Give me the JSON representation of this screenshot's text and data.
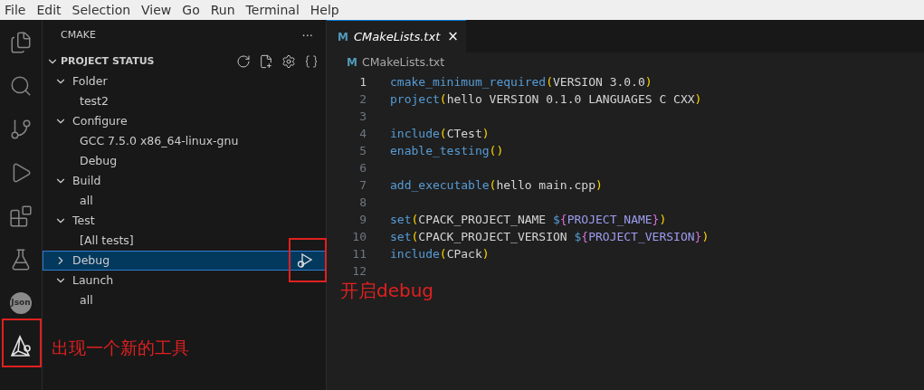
{
  "menu": [
    "File",
    "Edit",
    "Selection",
    "View",
    "Go",
    "Run",
    "Terminal",
    "Help"
  ],
  "activity_bar": [
    {
      "kind": "files"
    },
    {
      "kind": "search"
    },
    {
      "kind": "scm"
    },
    {
      "kind": "debug"
    },
    {
      "kind": "extensions"
    },
    {
      "kind": "flask"
    },
    {
      "kind": "json",
      "label": "Json"
    },
    {
      "kind": "cmake"
    }
  ],
  "sidebar": {
    "title": "CMAKE",
    "more": "···",
    "section": {
      "title": "PROJECT STATUS",
      "expanded": true,
      "actions": [
        {
          "kind": "refresh"
        },
        {
          "kind": "new-file"
        },
        {
          "kind": "settings"
        },
        {
          "kind": "braces"
        }
      ]
    },
    "items": [
      {
        "kind": "group",
        "label": "Folder",
        "expanded": true,
        "selected": false,
        "children": [
          {
            "label": "test2"
          }
        ]
      },
      {
        "kind": "group",
        "label": "Configure",
        "expanded": true,
        "selected": false,
        "children": [
          {
            "label": "GCC 7.5.0 x86_64-linux-gnu"
          },
          {
            "label": "Debug"
          }
        ]
      },
      {
        "kind": "group",
        "label": "Build",
        "expanded": true,
        "selected": false,
        "children": [
          {
            "label": "all"
          }
        ]
      },
      {
        "kind": "group",
        "label": "Test",
        "expanded": true,
        "selected": false,
        "children": [
          {
            "label": "[All tests]"
          }
        ]
      },
      {
        "kind": "debug",
        "label": "Debug",
        "expanded": false,
        "selected": true
      },
      {
        "kind": "group",
        "label": "Launch",
        "expanded": true,
        "selected": false,
        "children": [
          {
            "label": "all"
          }
        ]
      }
    ]
  },
  "editor": {
    "tabs": [
      {
        "icon": "M",
        "label": "CMakeLists.txt",
        "close": "×",
        "selected": true
      }
    ],
    "breadcrumb": {
      "icon": "M",
      "label": "CMakeLists.txt"
    },
    "lines": [
      {
        "number": "1",
        "tokens": [
          {
            "kind": "fn",
            "text": "cmake_minimum_required"
          },
          {
            "kind": "paren",
            "text": "("
          },
          {
            "kind": "text",
            "text": "VERSION 3.0.0"
          },
          {
            "kind": "paren",
            "text": ")"
          }
        ]
      },
      {
        "number": "2",
        "tokens": [
          {
            "kind": "fn",
            "text": "project"
          },
          {
            "kind": "paren",
            "text": "("
          },
          {
            "kind": "text",
            "text": "hello VERSION 0.1.0 LANGUAGES C CXX"
          },
          {
            "kind": "paren",
            "text": ")"
          }
        ]
      },
      {
        "number": "3"
      },
      {
        "number": "4",
        "tokens": [
          {
            "kind": "fn",
            "text": "include"
          },
          {
            "kind": "paren",
            "text": "("
          },
          {
            "kind": "text",
            "text": "CTest"
          },
          {
            "kind": "paren",
            "text": ")"
          }
        ]
      },
      {
        "number": "5",
        "tokens": [
          {
            "kind": "fn",
            "text": "enable_testing"
          },
          {
            "kind": "paren",
            "text": "()"
          }
        ]
      },
      {
        "number": "6"
      },
      {
        "number": "7",
        "tokens": [
          {
            "kind": "fn",
            "text": "add_executable"
          },
          {
            "kind": "paren",
            "text": "("
          },
          {
            "kind": "text",
            "text": "hello main.cpp"
          },
          {
            "kind": "paren",
            "text": ")"
          }
        ]
      },
      {
        "number": "8"
      },
      {
        "number": "9",
        "tokens": [
          {
            "kind": "fn",
            "text": "set"
          },
          {
            "kind": "paren",
            "text": "("
          },
          {
            "kind": "text",
            "text": "CPACK_PROJECT_NAME "
          },
          {
            "kind": "op",
            "text": "$"
          },
          {
            "kind": "brace",
            "text": "{"
          },
          {
            "kind": "var",
            "text": "PROJECT_NAME"
          },
          {
            "kind": "brace",
            "text": "}"
          },
          {
            "kind": "paren",
            "text": ")"
          }
        ]
      },
      {
        "number": "10",
        "tokens": [
          {
            "kind": "fn",
            "text": "set"
          },
          {
            "kind": "paren",
            "text": "("
          },
          {
            "kind": "text",
            "text": "CPACK_PROJECT_VERSION "
          },
          {
            "kind": "op",
            "text": "$"
          },
          {
            "kind": "brace",
            "text": "{"
          },
          {
            "kind": "var",
            "text": "PROJECT_VERSION"
          },
          {
            "kind": "brace",
            "text": "}"
          },
          {
            "kind": "paren",
            "text": ")"
          }
        ]
      },
      {
        "number": "11",
        "tokens": [
          {
            "kind": "fn",
            "text": "include"
          },
          {
            "kind": "paren",
            "text": "("
          },
          {
            "kind": "text",
            "text": "CPack"
          },
          {
            "kind": "paren",
            "text": ")"
          }
        ]
      },
      {
        "number": "12"
      }
    ]
  },
  "annotations": [
    {
      "kind": "action",
      "text": "开启debug"
    },
    {
      "kind": "tool",
      "text": "出现一个新的工具"
    }
  ]
}
